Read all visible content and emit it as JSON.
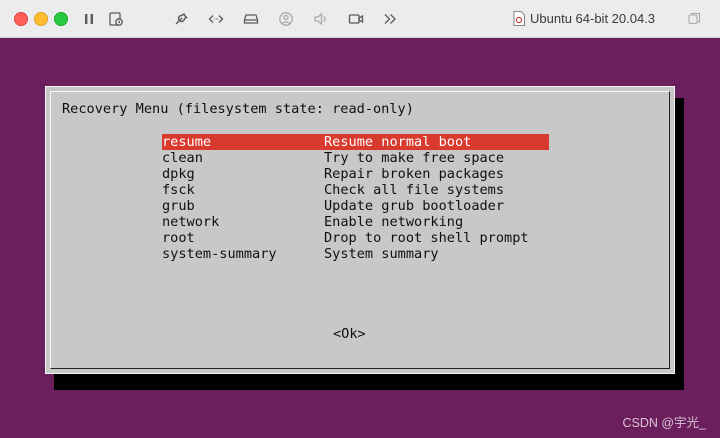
{
  "window": {
    "title": "Ubuntu 64-bit 20.04.3",
    "toolbar_icons": [
      "pause-icon",
      "snapshot-icon",
      "settings-wrench-icon",
      "code-arrows-icon",
      "drive-icon",
      "user-icon",
      "volume-icon",
      "camera-icon",
      "more-chevrons-icon"
    ]
  },
  "dialog": {
    "title": "Recovery Menu (filesystem state: read-only)",
    "items": [
      {
        "key": "resume",
        "desc": "Resume normal boot",
        "selected": true
      },
      {
        "key": "clean",
        "desc": "Try to make free space",
        "selected": false
      },
      {
        "key": "dpkg",
        "desc": "Repair broken packages",
        "selected": false
      },
      {
        "key": "fsck",
        "desc": "Check all file systems",
        "selected": false
      },
      {
        "key": "grub",
        "desc": "Update grub bootloader",
        "selected": false
      },
      {
        "key": "network",
        "desc": "Enable networking",
        "selected": false
      },
      {
        "key": "root",
        "desc": "Drop to root shell prompt",
        "selected": false
      },
      {
        "key": "system-summary",
        "desc": "System summary",
        "selected": false
      }
    ],
    "ok_label": "<Ok>"
  },
  "colors": {
    "desktop": "#6b1f5c",
    "dialog": "#c8c8c8",
    "selection": "#d93a2e"
  },
  "watermark": "CSDN @宇光_"
}
